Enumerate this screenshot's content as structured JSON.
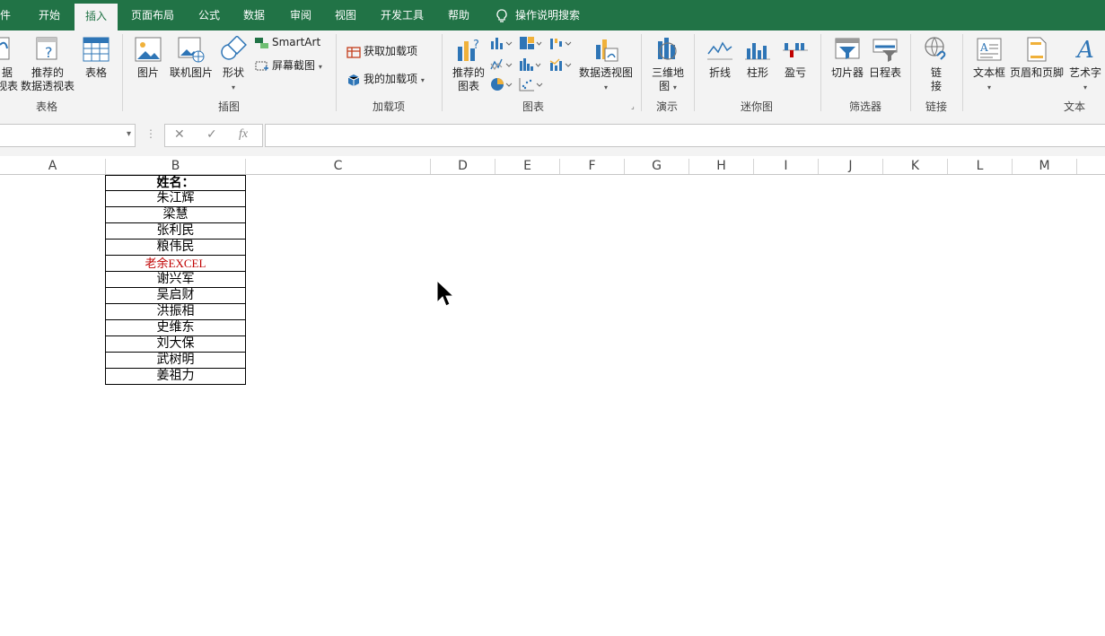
{
  "tabs": [
    {
      "label": "件",
      "active": false
    },
    {
      "label": "开始",
      "active": false
    },
    {
      "label": "插入",
      "active": true
    },
    {
      "label": "页面布局",
      "active": false
    },
    {
      "label": "公式",
      "active": false
    },
    {
      "label": "数据",
      "active": false
    },
    {
      "label": "审阅",
      "active": false
    },
    {
      "label": "视图",
      "active": false
    },
    {
      "label": "开发工具",
      "active": false
    },
    {
      "label": "帮助",
      "active": false
    }
  ],
  "tell_me": "操作说明搜索",
  "ribbon": {
    "tables": {
      "pivot_partial_line1": "据",
      "pivot_partial_line2": "视表",
      "recommended_pivot_line1": "推荐的",
      "recommended_pivot_line2": "数据透视表",
      "table": "表格",
      "group": "表格"
    },
    "illustrations": {
      "pictures": "图片",
      "online_pictures": "联机图片",
      "shapes": "形状",
      "smartart": "SmartArt",
      "screenshot": "屏幕截图",
      "group": "插图"
    },
    "addins": {
      "get_addins": "获取加载项",
      "my_addins": "我的加载项",
      "group": "加载项"
    },
    "charts": {
      "recommended_line1": "推荐的",
      "recommended_line2": "图表",
      "pivot_chart": "数据透视图",
      "group": "图表"
    },
    "tours": {
      "map_line1": "三维地",
      "map_line2": "图",
      "group": "演示"
    },
    "sparklines": {
      "line": "折线",
      "column": "柱形",
      "winloss": "盈亏",
      "group": "迷你图"
    },
    "filters": {
      "slicer": "切片器",
      "timeline": "日程表",
      "group": "筛选器"
    },
    "links": {
      "link_line1": "链",
      "link_line2": "接",
      "group": "链接"
    },
    "text": {
      "textbox": "文本框",
      "header_footer": "页眉和页脚",
      "wordart": "艺术字",
      "group": "文本"
    }
  },
  "formula_bar": {
    "cancel": "✕",
    "enter": "✓",
    "fx": "fx",
    "value": ""
  },
  "columns": [
    "A",
    "B",
    "C",
    "D",
    "E",
    "F",
    "G",
    "H",
    "I",
    "J",
    "K",
    "L",
    "M"
  ],
  "cells": [
    {
      "text": "姓名：",
      "style": "header"
    },
    {
      "text": "朱江辉",
      "style": "normal"
    },
    {
      "text": "梁慧",
      "style": "normal"
    },
    {
      "text": "张利民",
      "style": "normal"
    },
    {
      "text": "粮伟民",
      "style": "normal"
    },
    {
      "text": "老余EXCEL",
      "style": "red"
    },
    {
      "text": "谢兴军",
      "style": "normal"
    },
    {
      "text": "吴启财",
      "style": "normal"
    },
    {
      "text": "洪振相",
      "style": "normal"
    },
    {
      "text": "史维东",
      "style": "normal"
    },
    {
      "text": "刘大保",
      "style": "normal"
    },
    {
      "text": "武树明",
      "style": "normal"
    },
    {
      "text": "姜祖力",
      "style": "normal"
    }
  ],
  "colors": {
    "accent": "#217346",
    "red_text": "#c00000"
  }
}
